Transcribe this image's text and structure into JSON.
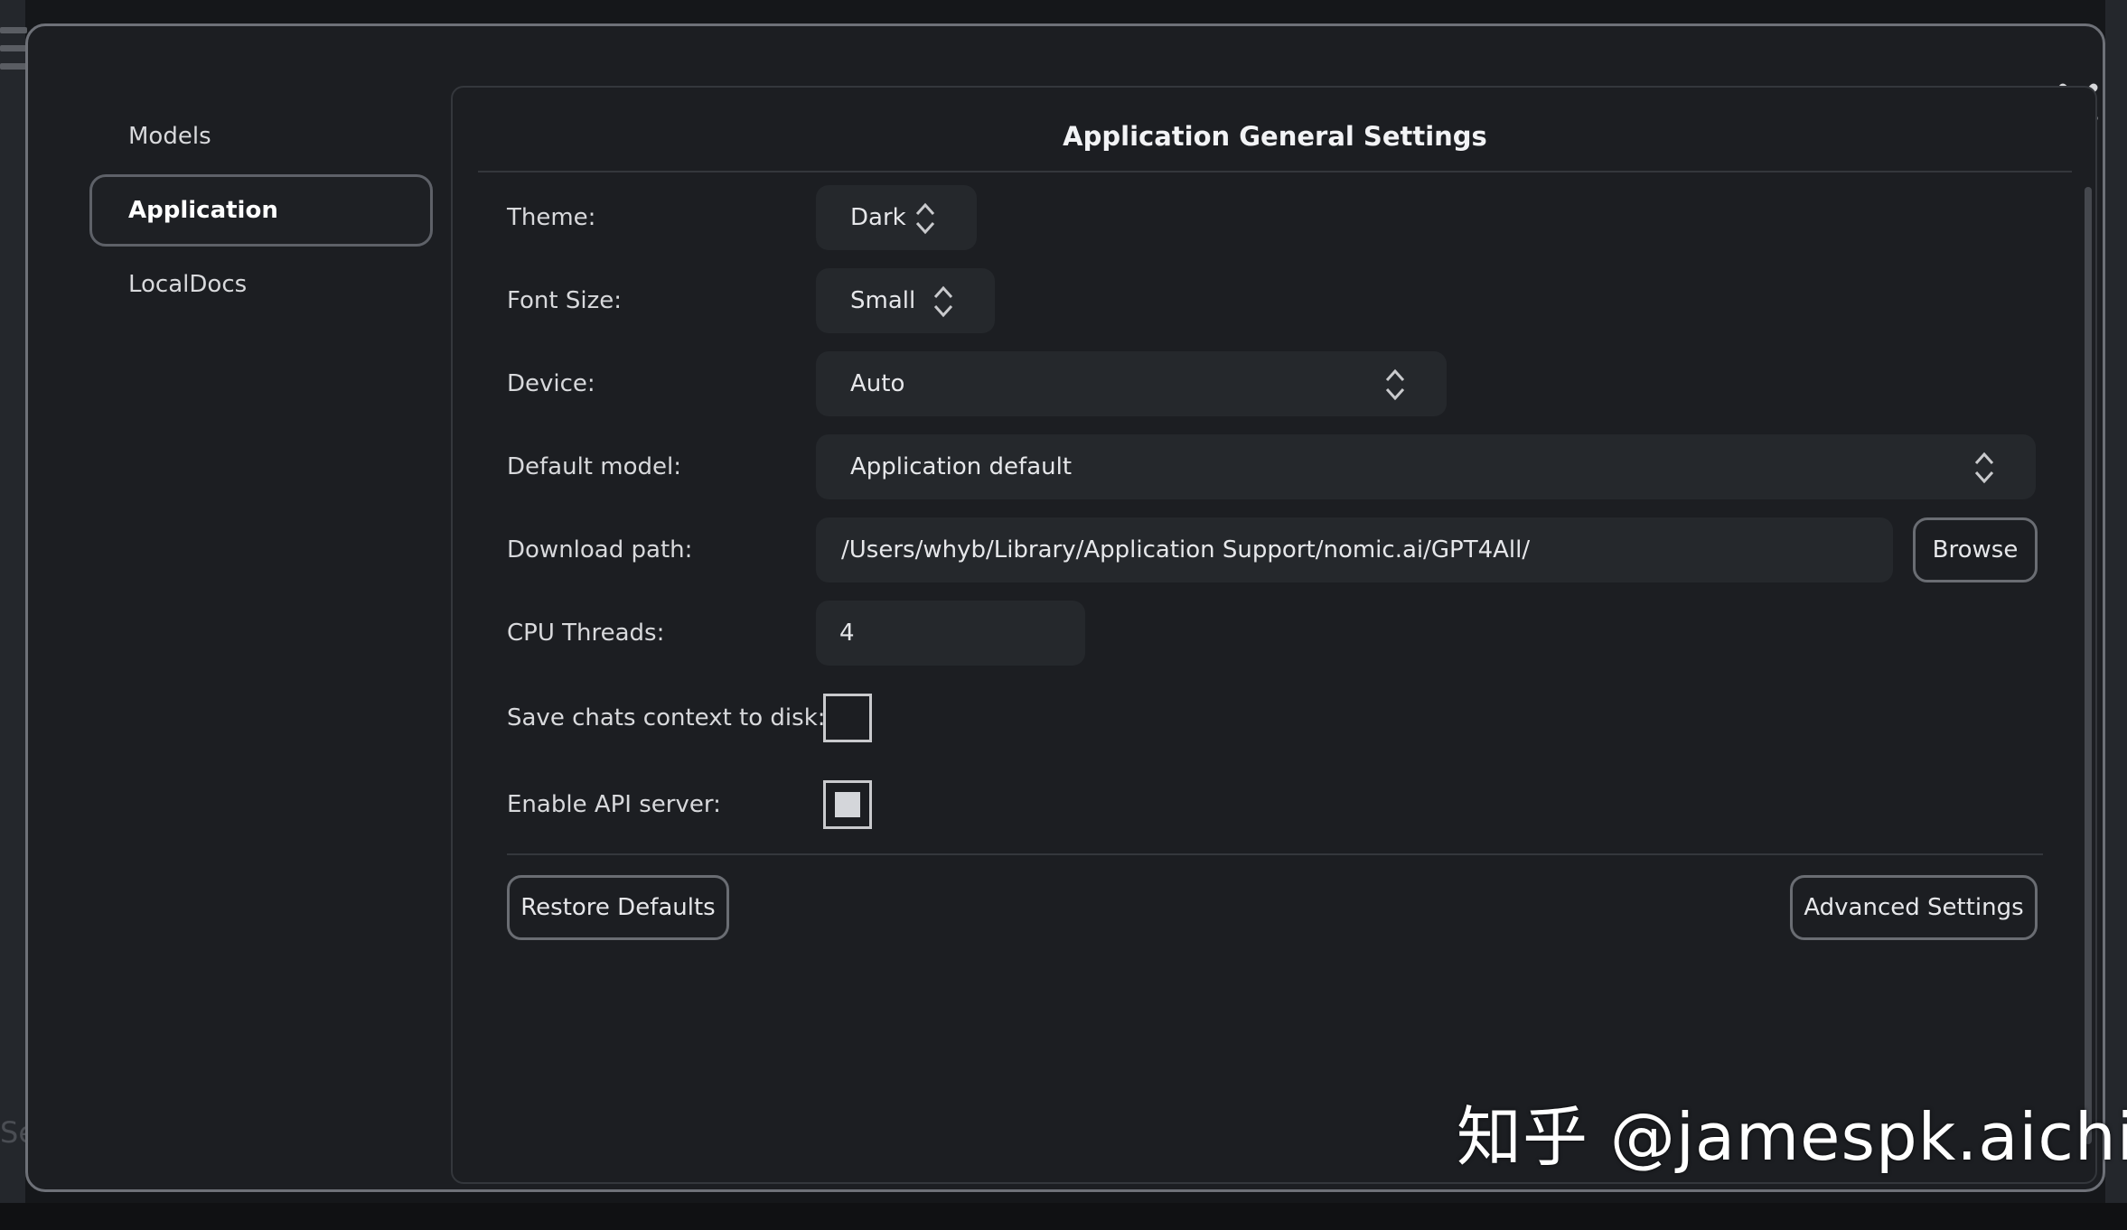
{
  "colors": {
    "background": "#1c1e22",
    "field_bg": "#25282c",
    "border": "#6a6d73",
    "text": "#e6e7ea"
  },
  "background": {
    "peek_text": "Se"
  },
  "sidebar": {
    "items": [
      {
        "label": "Models",
        "active": false
      },
      {
        "label": "Application",
        "active": true
      },
      {
        "label": "LocalDocs",
        "active": false
      }
    ]
  },
  "panel": {
    "title": "Application General Settings",
    "theme": {
      "label": "Theme:",
      "value": "Dark"
    },
    "font_size": {
      "label": "Font Size:",
      "value": "Small"
    },
    "device": {
      "label": "Device:",
      "value": "Auto"
    },
    "default_model": {
      "label": "Default model:",
      "value": "Application default"
    },
    "download_path": {
      "label": "Download path:",
      "value": "/Users/whyb/Library/Application Support/nomic.ai/GPT4All/",
      "browse_label": "Browse"
    },
    "cpu_threads": {
      "label": "CPU Threads:",
      "value": "4"
    },
    "save_chats": {
      "label": "Save chats context to disk:",
      "checked": false
    },
    "api_server": {
      "label": "Enable API server:",
      "checked": true
    },
    "restore_label": "Restore Defaults",
    "advanced_label": "Advanced Settings"
  },
  "close_icon": "close-icon",
  "watermark": "知乎 @jamespk.aichi"
}
